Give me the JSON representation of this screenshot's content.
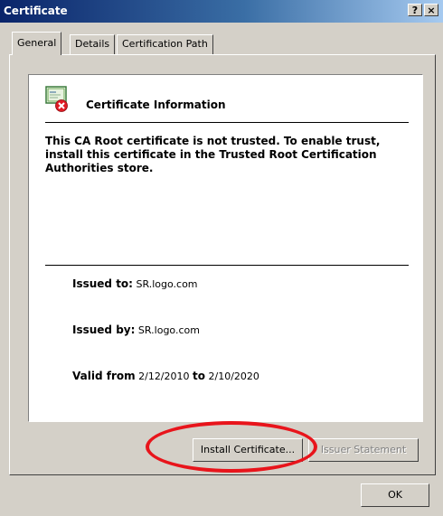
{
  "window": {
    "title": "Certificate",
    "help_button": "?",
    "close_button": "×"
  },
  "tabs": [
    {
      "label": "General",
      "active": true
    },
    {
      "label": "Details",
      "active": false
    },
    {
      "label": "Certification Path",
      "active": false
    }
  ],
  "cert": {
    "icon": "certificate-error-icon",
    "heading": "Certificate Information",
    "warning": "This CA Root certificate is not trusted. To enable trust, install this certificate in the Trusted Root Certification Authorities store.",
    "issued_to_label": "Issued to:",
    "issued_to_value": "SR.logo.com",
    "issued_by_label": "Issued by:",
    "issued_by_value": "SR.logo.com",
    "valid_from_label": "Valid from",
    "valid_from_value": "2/12/2010",
    "valid_to_label": "to",
    "valid_to_value": "2/10/2020"
  },
  "buttons": {
    "install": "Install Certificate...",
    "issuer_statement": "Issuer Statement",
    "ok": "OK"
  },
  "colors": {
    "titlebar_start": "#0a246a",
    "highlight_ring": "#e8141b",
    "dialog_bg": "#d4d0c8"
  }
}
